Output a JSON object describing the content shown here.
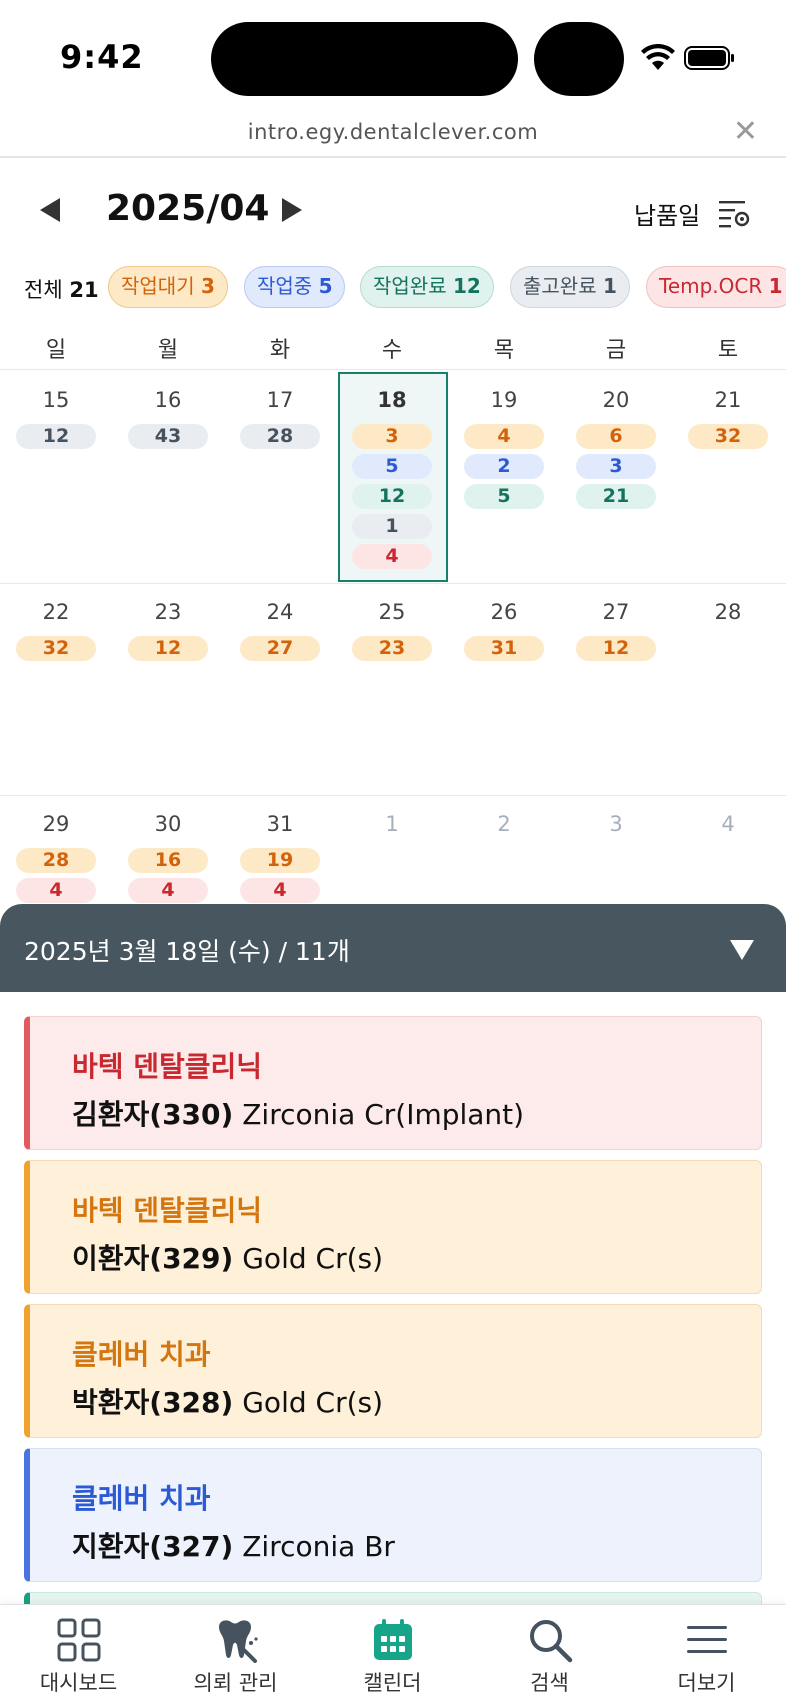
{
  "status_bar": {
    "time": "9:42"
  },
  "browser": {
    "url": "intro.egy.dentalclever.com",
    "close_icon": "close-icon"
  },
  "calendar_header": {
    "month": "2025/04",
    "date_type": "납품일"
  },
  "status_chips": {
    "total_label": "전체",
    "total_count": "21",
    "items": [
      {
        "label": "작업대기",
        "count": "3",
        "color": "orange"
      },
      {
        "label": "작업중",
        "count": "5",
        "color": "blue"
      },
      {
        "label": "작업완료",
        "count": "12",
        "color": "green"
      },
      {
        "label": "출고완료",
        "count": "1",
        "color": "gray"
      },
      {
        "label": "Temp.OCR",
        "count": "1",
        "color": "red"
      }
    ]
  },
  "weekdays": [
    "일",
    "월",
    "화",
    "수",
    "목",
    "금",
    "토"
  ],
  "weeks": [
    {
      "days": [
        {
          "day": "15",
          "counts": [
            {
              "value": "12",
              "color": "gray"
            }
          ]
        },
        {
          "day": "16",
          "counts": [
            {
              "value": "43",
              "color": "gray"
            }
          ]
        },
        {
          "day": "17",
          "counts": [
            {
              "value": "28",
              "color": "gray"
            }
          ]
        },
        {
          "day": "18",
          "selected": true,
          "counts": [
            {
              "value": "3",
              "color": "orange"
            },
            {
              "value": "5",
              "color": "blue"
            },
            {
              "value": "12",
              "color": "green"
            },
            {
              "value": "1",
              "color": "gray"
            },
            {
              "value": "4",
              "color": "red"
            }
          ]
        },
        {
          "day": "19",
          "counts": [
            {
              "value": "4",
              "color": "orange"
            },
            {
              "value": "2",
              "color": "blue"
            },
            {
              "value": "5",
              "color": "green"
            }
          ]
        },
        {
          "day": "20",
          "counts": [
            {
              "value": "6",
              "color": "orange"
            },
            {
              "value": "3",
              "color": "blue"
            },
            {
              "value": "21",
              "color": "green"
            }
          ]
        },
        {
          "day": "21",
          "counts": [
            {
              "value": "32",
              "color": "orange"
            }
          ]
        }
      ]
    },
    {
      "days": [
        {
          "day": "22",
          "counts": [
            {
              "value": "32",
              "color": "orange"
            }
          ]
        },
        {
          "day": "23",
          "counts": [
            {
              "value": "12",
              "color": "orange"
            }
          ]
        },
        {
          "day": "24",
          "counts": [
            {
              "value": "27",
              "color": "orange"
            }
          ]
        },
        {
          "day": "25",
          "counts": [
            {
              "value": "23",
              "color": "orange"
            }
          ]
        },
        {
          "day": "26",
          "counts": [
            {
              "value": "31",
              "color": "orange"
            }
          ]
        },
        {
          "day": "27",
          "counts": [
            {
              "value": "12",
              "color": "orange"
            }
          ]
        },
        {
          "day": "28",
          "counts": []
        }
      ]
    },
    {
      "days": [
        {
          "day": "29",
          "counts": [
            {
              "value": "28",
              "color": "orange"
            },
            {
              "value": "4",
              "color": "red"
            }
          ]
        },
        {
          "day": "30",
          "counts": [
            {
              "value": "16",
              "color": "orange"
            },
            {
              "value": "4",
              "color": "red"
            }
          ]
        },
        {
          "day": "31",
          "counts": [
            {
              "value": "19",
              "color": "orange"
            },
            {
              "value": "4",
              "color": "red"
            }
          ]
        },
        {
          "day": "1",
          "other_month": true,
          "counts": []
        },
        {
          "day": "2",
          "other_month": true,
          "counts": []
        },
        {
          "day": "3",
          "other_month": true,
          "counts": []
        },
        {
          "day": "4",
          "other_month": true,
          "counts": []
        }
      ]
    }
  ],
  "sheet": {
    "title": "2025년 3월 18일 (수) / 11개"
  },
  "orders": [
    {
      "clinic": "바텍 덴탈클리닉",
      "patient": "김환자(330)",
      "item": "Zirconia Cr(Implant)",
      "color": "red"
    },
    {
      "clinic": "바텍 덴탈클리닉",
      "patient": "이환자(329)",
      "item": "Gold Cr(s)",
      "color": "orange"
    },
    {
      "clinic": "클레버 치과",
      "patient": "박환자(328)",
      "item": "Gold Cr(s)",
      "color": "orange"
    },
    {
      "clinic": "클레버 치과",
      "patient": "지환자(327)",
      "item": "Zirconia Br",
      "color": "blue"
    },
    {
      "clinic": "",
      "patient": "",
      "item": "",
      "color": "green"
    }
  ],
  "tabs": [
    {
      "label": "대시보드",
      "icon": "dashboard-icon"
    },
    {
      "label": "의뢰 관리",
      "icon": "tooth-icon"
    },
    {
      "label": "캘린더",
      "icon": "calendar-icon",
      "active": true
    },
    {
      "label": "검색",
      "icon": "search-icon"
    },
    {
      "label": "더보기",
      "icon": "menu-icon"
    }
  ],
  "colors": {
    "accent": "#17806c",
    "sheet_header": "#48565f",
    "orange": "#d4620b",
    "blue": "#2b5ad4",
    "green": "#14735e",
    "gray": "#46535f",
    "red": "#c8282f"
  }
}
